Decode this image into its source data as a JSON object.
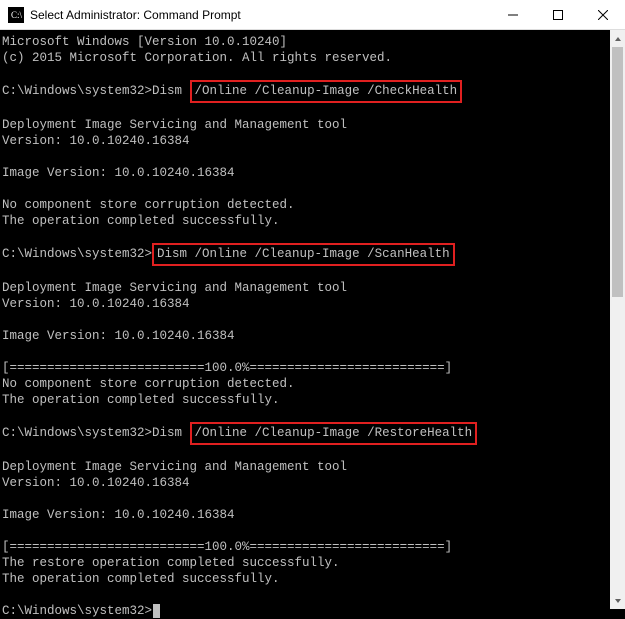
{
  "window": {
    "title": "Select Administrator: Command Prompt"
  },
  "highlight_color": "#e02020",
  "console": {
    "lines": [
      {
        "t": "Microsoft Windows [Version 10.0.10240]"
      },
      {
        "t": "(c) 2015 Microsoft Corporation. All rights reserved."
      },
      {
        "t": ""
      },
      {
        "prompt": "C:\\Windows\\system32>",
        "pre": "Dism ",
        "hl": "/Online /Cleanup-Image /CheckHealth",
        "hlclass": "hl1"
      },
      {
        "t": ""
      },
      {
        "t": "Deployment Image Servicing and Management tool"
      },
      {
        "t": "Version: 10.0.10240.16384"
      },
      {
        "t": ""
      },
      {
        "t": "Image Version: 10.0.10240.16384"
      },
      {
        "t": ""
      },
      {
        "t": "No component store corruption detected."
      },
      {
        "t": "The operation completed successfully."
      },
      {
        "t": ""
      },
      {
        "prompt": "C:\\Windows\\system32>",
        "pre": "",
        "hl": "Dism /Online /Cleanup-Image /ScanHealth",
        "hlclass": "hl2"
      },
      {
        "t": ""
      },
      {
        "t": "Deployment Image Servicing and Management tool"
      },
      {
        "t": "Version: 10.0.10240.16384"
      },
      {
        "t": ""
      },
      {
        "t": "Image Version: 10.0.10240.16384"
      },
      {
        "t": ""
      },
      {
        "t": "[==========================100.0%==========================]"
      },
      {
        "t": "No component store corruption detected."
      },
      {
        "t": "The operation completed successfully."
      },
      {
        "t": ""
      },
      {
        "prompt": "C:\\Windows\\system32>",
        "pre": "Dism ",
        "hl": "/Online /Cleanup-Image /RestoreHealth",
        "hlclass": "hl3"
      },
      {
        "t": ""
      },
      {
        "t": "Deployment Image Servicing and Management tool"
      },
      {
        "t": "Version: 10.0.10240.16384"
      },
      {
        "t": ""
      },
      {
        "t": "Image Version: 10.0.10240.16384"
      },
      {
        "t": ""
      },
      {
        "t": "[==========================100.0%==========================]"
      },
      {
        "t": "The restore operation completed successfully."
      },
      {
        "t": "The operation completed successfully."
      },
      {
        "t": ""
      },
      {
        "prompt": "C:\\Windows\\system32>",
        "cursor": true
      }
    ]
  }
}
